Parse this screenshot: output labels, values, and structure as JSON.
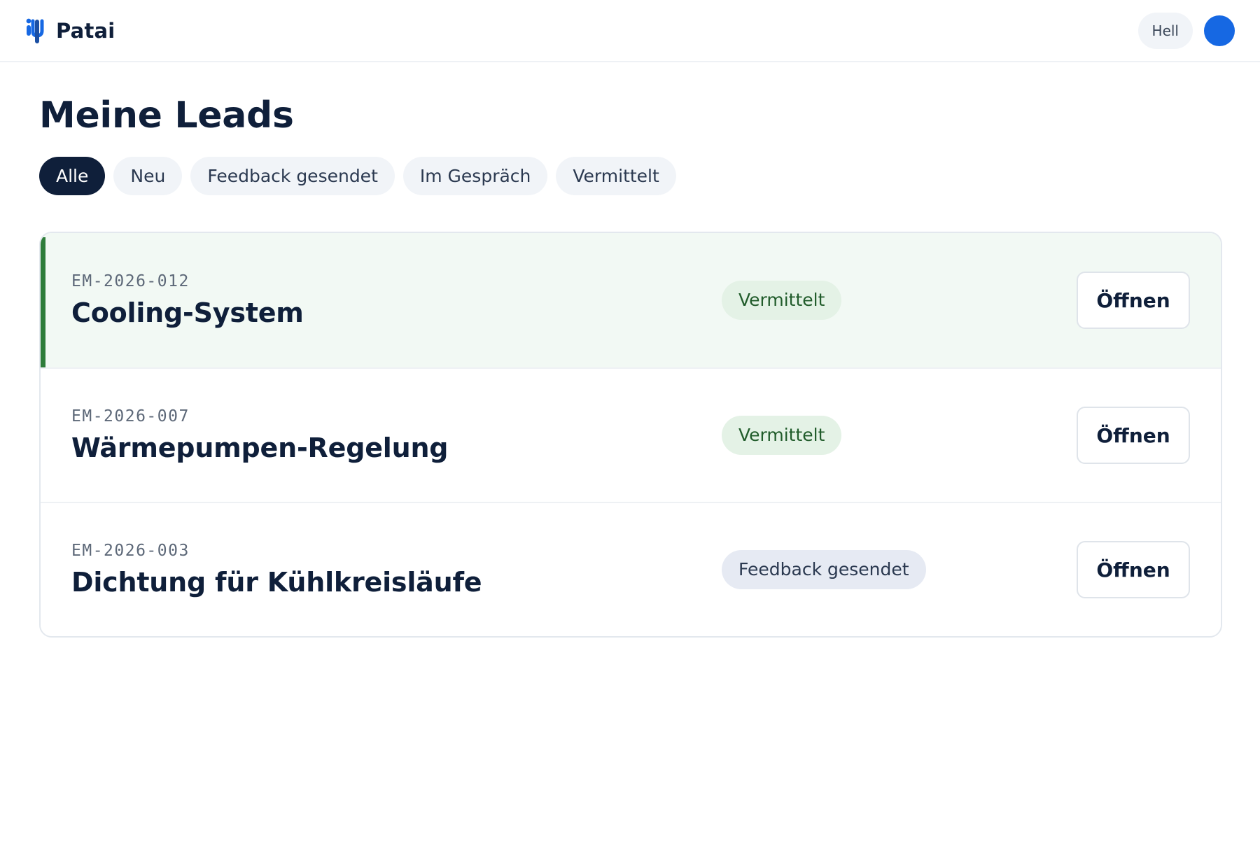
{
  "app": {
    "name": "Patai",
    "logo_icon": "patai-logo-icon"
  },
  "header": {
    "theme_label": "Hell",
    "avatar_color": "#1668e3"
  },
  "page": {
    "title": "Meine Leads"
  },
  "filters": [
    {
      "label": "Alle",
      "active": true
    },
    {
      "label": "Neu",
      "active": false
    },
    {
      "label": "Feedback gesendet",
      "active": false
    },
    {
      "label": "Im Gespräch",
      "active": false
    },
    {
      "label": "Vermittelt",
      "active": false
    }
  ],
  "leads": [
    {
      "id": "EM-2026-012",
      "title": "Cooling-System",
      "status": "Vermittelt",
      "status_color": "#215c2b",
      "action": "Öffnen",
      "highlighted": true
    },
    {
      "id": "EM-2026-007",
      "title": "Wärmepumpen-Regelung",
      "status": "Vermittelt",
      "status_color": "#215c2b",
      "action": "Öffnen",
      "highlighted": false
    },
    {
      "id": "EM-2026-003",
      "title": "Dichtung für Kühlkreisläufe",
      "status": "Feedback gesendet",
      "status_color": "#2b3950",
      "action": "Öffnen",
      "highlighted": false
    }
  ],
  "colors": {
    "primary_dark": "#0f1f3a",
    "accent_green": "#2e7d3a",
    "brand_blue": "#1668e3"
  }
}
